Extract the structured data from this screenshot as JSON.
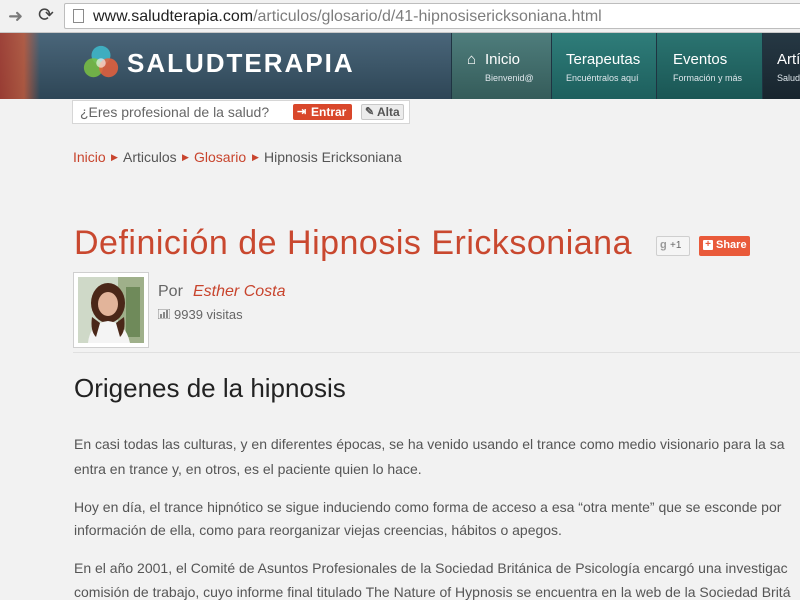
{
  "browser": {
    "url_host": "www.saludterapia.com",
    "url_path": "/articulos/glosario/d/41-hipnosisericksoniana.html"
  },
  "header": {
    "logo_text": "SALUDTERAPIA",
    "nav": [
      {
        "title": "Inicio",
        "subtitle": "Bienvenid@"
      },
      {
        "title": "Terapeutas",
        "subtitle": "Encuéntralos aquí"
      },
      {
        "title": "Eventos",
        "subtitle": "Formación y más"
      },
      {
        "title": "Artí",
        "subtitle": "Salud"
      }
    ]
  },
  "pro_bar": {
    "question": "¿Eres profesional de la salud?",
    "login_label": "Entrar",
    "signup_label": "Alta"
  },
  "breadcrumb": [
    "Inicio",
    "Articulos",
    "Glosario",
    "Hipnosis Ericksoniana"
  ],
  "article": {
    "title": "Definición de Hipnosis Ericksoniana",
    "gplus_label": "+1",
    "share_label": "Share",
    "author_prefix": "Por",
    "author": "Esther Costa",
    "visits": "9939 visitas",
    "section_title": "Origenes de la hipnosis",
    "paragraphs": [
      "En casi todas las culturas, y en diferentes épocas, se ha venido usando el trance como medio visionario para la sa",
      "entra en trance y, en otros, es el paciente quien lo hace.",
      "Hoy en día, el trance hipnótico se sigue induciendo como forma de acceso a esa “otra mente” que se esconde por",
      "información de ella, como para reorganizar viejas creencias, hábitos o apegos.",
      "En el año 2001, el Comité de Asuntos Profesionales de la Sociedad Británica de Psicología encargó una investigac",
      "comisión de trabajo, cuyo informe final titulado The Nature of Hypnosis se encuentra en la web de la Sociedad Britá"
    ]
  },
  "colors": {
    "accent": "#c9482f",
    "header_bg": "#3a5566"
  }
}
